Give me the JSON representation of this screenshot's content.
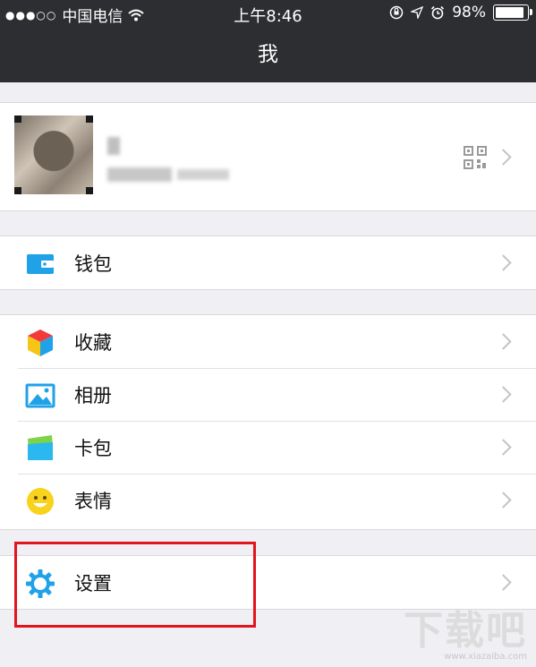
{
  "status_bar": {
    "carrier": "中国电信",
    "time": "上午8:46",
    "battery_percent": "98%",
    "battery_level": 0.98
  },
  "nav": {
    "title": "我"
  },
  "profile": {
    "name": "?"
  },
  "menu": {
    "wallet": "钱包",
    "favorites": "收藏",
    "album": "相册",
    "card_pack": "卡包",
    "stickers": "表情",
    "settings": "设置"
  },
  "watermark": {
    "text": "下载吧",
    "url": "www.xiazaiba.com"
  },
  "colors": {
    "nav_bg": "#2d2e31",
    "icon_blue": "#1fa2e8",
    "highlight_red": "#e3141e"
  }
}
